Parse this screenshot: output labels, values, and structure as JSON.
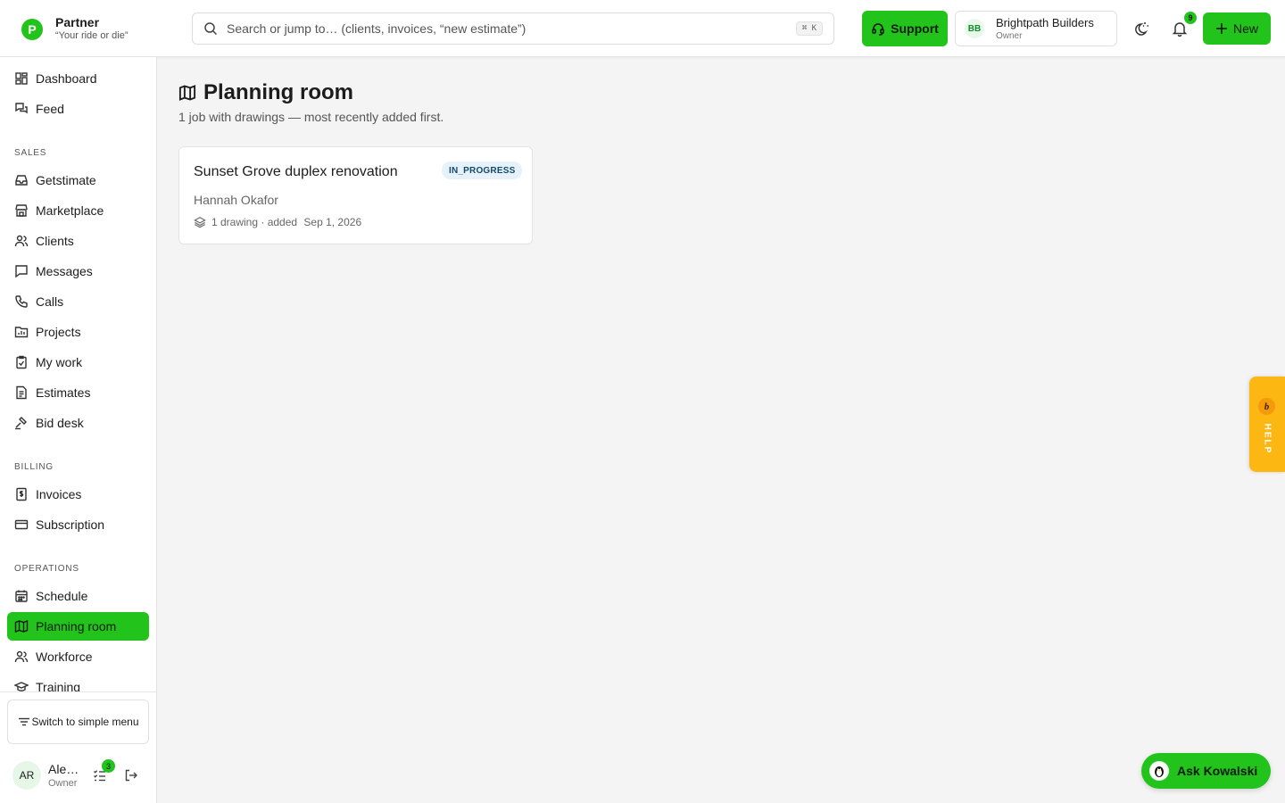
{
  "brand": {
    "logo_letter": "P",
    "name": "Partner",
    "tagline": "“Your ride or die”"
  },
  "search": {
    "placeholder": "Search or jump to… (clients, invoices, “new estimate”)",
    "shortcut": "⌘ K"
  },
  "header": {
    "support_label": "Support",
    "org_initials": "BB",
    "org_name": "Brightpath Builders",
    "org_role": "Owner",
    "notification_count": "9",
    "new_label": "New"
  },
  "sidebar": {
    "items_top": [
      {
        "label": "Dashboard",
        "icon": "grid-icon"
      },
      {
        "label": "Feed",
        "icon": "chat-bubbles-icon"
      }
    ],
    "sections": [
      {
        "label": "SALES",
        "items": [
          "Getstimate",
          "Marketplace",
          "Clients",
          "Messages",
          "Calls",
          "Projects",
          "My work",
          "Estimates",
          "Bid desk"
        ]
      },
      {
        "label": "BILLING",
        "items": [
          "Invoices",
          "Subscription"
        ]
      },
      {
        "label": "OPERATIONS",
        "items": [
          "Schedule",
          "Planning room",
          "Workforce",
          "Training"
        ]
      }
    ],
    "active_item": "Planning room",
    "switch_label": "Switch to simple menu",
    "user": {
      "initials": "AR",
      "name": "Ale…",
      "role": "Owner",
      "task_count": "3"
    }
  },
  "main": {
    "title": "Planning room",
    "subtitle": "1 job with drawings — most recently added first.",
    "jobs": [
      {
        "title": "Sunset Grove duplex renovation",
        "status": "IN_PROGRESS",
        "client": "Hannah Okafor",
        "meta_count": "1 drawing",
        "meta_sep": " · added ",
        "meta_date": "Sep 1, 2026"
      }
    ]
  },
  "help_tab": {
    "letter": "b",
    "label": "HELP"
  },
  "assistant": {
    "label": "Ask Kowalski"
  },
  "colors": {
    "accent": "#22c31a",
    "help": "#fdb713",
    "badge_bg": "#e6f1fa",
    "badge_text": "#134a6c"
  }
}
